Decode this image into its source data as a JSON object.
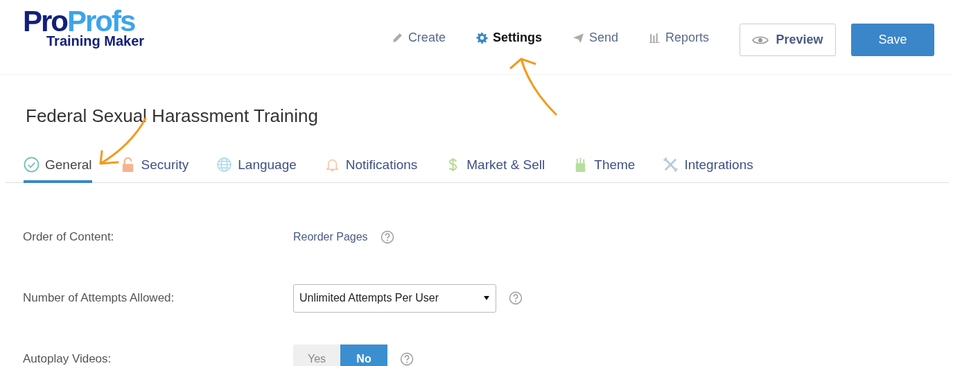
{
  "logo": {
    "brand_dark": "Pro",
    "brand_light": "Profs",
    "subtitle": "Training Maker"
  },
  "nav": [
    {
      "label": "Create",
      "selected": false
    },
    {
      "label": "Settings",
      "selected": true
    },
    {
      "label": "Send",
      "selected": false
    },
    {
      "label": "Reports",
      "selected": false
    }
  ],
  "preview_button": "Preview",
  "save_button": "Save",
  "title": "Federal Sexual Harassment Training",
  "tabs": [
    {
      "label": "General",
      "selected": true
    },
    {
      "label": "Security",
      "selected": false
    },
    {
      "label": "Language",
      "selected": false
    },
    {
      "label": "Notifications",
      "selected": false
    },
    {
      "label": "Market & Sell",
      "selected": false
    },
    {
      "label": "Theme",
      "selected": false
    },
    {
      "label": "Integrations",
      "selected": false
    }
  ],
  "settings": [
    {
      "kind": "link",
      "label": "Order of Content:",
      "value": "Reorder Pages"
    },
    {
      "kind": "select",
      "label": "Number of Attempts Allowed:",
      "value": "Unlimited Attempts Per User"
    },
    {
      "kind": "toggle",
      "label": "Autoplay Videos:",
      "options": [
        {
          "label": "Yes",
          "selected": false
        },
        {
          "label": "No",
          "selected": true
        }
      ]
    }
  ]
}
